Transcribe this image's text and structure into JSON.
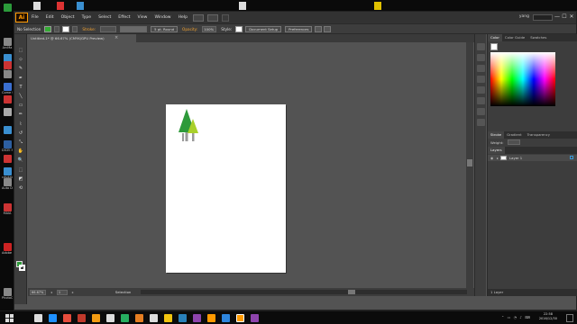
{
  "desktop": {
    "icons": [
      {
        "label": "",
        "color": "#2b9a3a"
      },
      {
        "label": "ArcMa",
        "color": "#888"
      },
      {
        "label": "",
        "color": "#3a8fd0"
      },
      {
        "label": "BLSY",
        "color": "#c33"
      },
      {
        "label": "",
        "color": "#888"
      },
      {
        "label": "Come Shor",
        "color": "#3a6fd0"
      },
      {
        "label": "",
        "color": "#c33"
      },
      {
        "label": "",
        "color": "#aaa"
      },
      {
        "label": "",
        "color": "#3a8fd0"
      },
      {
        "label": "DICEI Shor",
        "color": "#2d5fa0"
      },
      {
        "label": "",
        "color": "#c33"
      },
      {
        "label": "cdsdat",
        "color": "#3a8fd0"
      },
      {
        "label": "Auto Desktop",
        "color": "#888"
      },
      {
        "label": "MAIA",
        "color": "#c33"
      },
      {
        "label": "Adobe Creat",
        "color": "#c22"
      },
      {
        "label": "PhotoCap",
        "color": "#888"
      }
    ],
    "top_icons": [
      "#ddd",
      "#d33",
      "#3a8fd0",
      "#ddd",
      "#e0c000"
    ]
  },
  "app": {
    "logo": "Ai",
    "menus": [
      "File",
      "Edit",
      "Object",
      "Type",
      "Select",
      "Effect",
      "View",
      "Window",
      "Help"
    ],
    "workspace_label": "yang",
    "window_buttons": [
      "—",
      "☐",
      "✕"
    ],
    "colors": {
      "accent": "#ff9a00",
      "chrome": "#535353",
      "panel": "#3d3d3d",
      "menubar": "#323232"
    }
  },
  "controlbar": {
    "selection": "No Selection",
    "stroke_label": "Stroke:",
    "stroke_value": "",
    "brush_label": "5 pt. Round",
    "opacity_label": "Opacity:",
    "opacity_value": "100%",
    "style_label": "Style:",
    "doc_setup": "Document Setup",
    "preferences": "Preferences"
  },
  "document": {
    "tab_title": "Untitled-1* @ 66.67% (CMYK/GPU Preview)",
    "tab_close": "×"
  },
  "tools": [
    "⬚",
    "⬦",
    "✎",
    "✒",
    "T",
    "╲",
    "▭",
    "✏",
    "⌇",
    "↺",
    "⤡",
    "✋",
    "🔍",
    "⬚",
    "◩",
    "⟲"
  ],
  "statusbar": {
    "zoom": "66.67%",
    "artboard": "1",
    "status": "Selection"
  },
  "panels": {
    "top_tabs": [
      "Color",
      "Color Guide",
      "Swatches"
    ],
    "stroke_tabs": [
      "Stroke",
      "Gradient",
      "Transparency"
    ],
    "weight_label": "Weight:",
    "layers_tab": "Layers",
    "layer_name": "Layer 1",
    "layers_footer": "1 Layer"
  },
  "taskbar": {
    "icons": [
      "#ddd",
      "#1e90ff",
      "#e74c3c",
      "#c0392b",
      "#f39c12",
      "#ddd",
      "#27ae60",
      "#e67e22",
      "#ddd",
      "#f1c40f",
      "#2980b9",
      "#8e44ad",
      "#ff9a00",
      "#2e86de",
      "#ff9a00",
      "#8e44ad"
    ],
    "time": "22:58",
    "date": "2016/12/30"
  },
  "artwork": {
    "trees": [
      {
        "color": "#2e9a3a"
      },
      {
        "color": "#a9d02a"
      }
    ],
    "trunk_color": "#9a9a9a"
  }
}
